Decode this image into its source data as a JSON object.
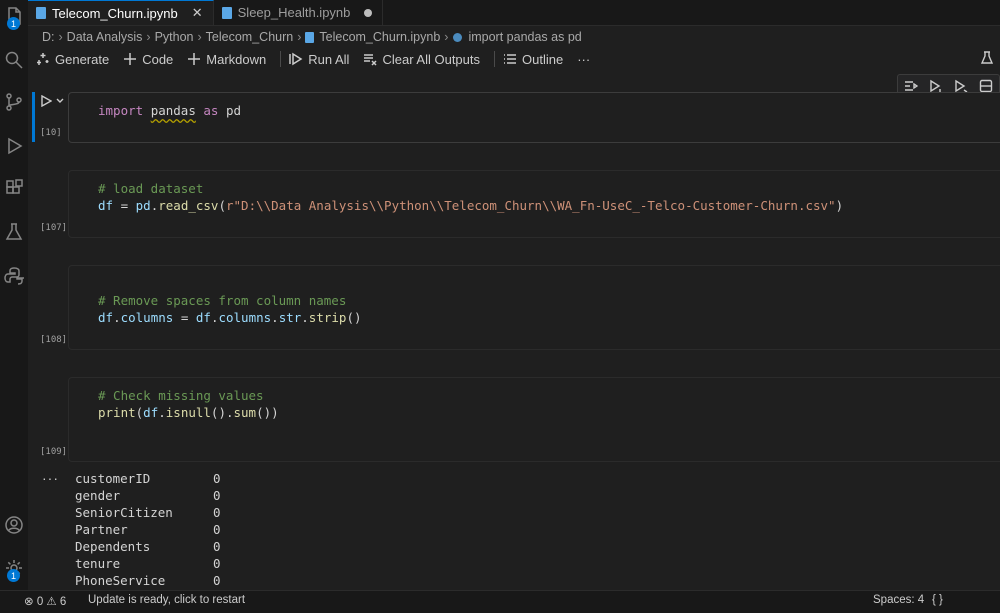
{
  "tabs": [
    {
      "label": "Telecom_Churn.ipynb",
      "active": true
    },
    {
      "label": "Sleep_Health.ipynb",
      "active": false
    }
  ],
  "breadcrumb": [
    "D:",
    "Data Analysis",
    "Python",
    "Telecom_Churn",
    "Telecom_Churn.ipynb",
    "import pandas as pd"
  ],
  "toolbar": {
    "generate": "Generate",
    "code": "Code",
    "markdown": "Markdown",
    "run_all": "Run All",
    "clear_outputs": "Clear All Outputs",
    "outline": "Outline",
    "more": "···"
  },
  "badges": {
    "explorer": "1",
    "settings": "1"
  },
  "cells": [
    {
      "exec": "[10]",
      "lines": [
        "import pandas as pd"
      ]
    },
    {
      "exec": "[107]",
      "lines": [
        "# load dataset",
        "df = pd.read_csv(r\"D:\\\\Data Analysis\\\\Python\\\\Telecom_Churn\\\\WA_Fn-UseC_-Telco-Customer-Churn.csv\")"
      ]
    },
    {
      "exec": "[108]",
      "lines": [
        "# Remove spaces from column names",
        "df.columns = df.columns.str.strip()"
      ]
    },
    {
      "exec": "[109]",
      "lines": [
        "# Check missing values",
        "print(df.isnull().sum())"
      ]
    }
  ],
  "output_more": "···",
  "output": [
    {
      "name": "customerID",
      "value": "0"
    },
    {
      "name": "gender",
      "value": "0"
    },
    {
      "name": "SeniorCitizen",
      "value": "0"
    },
    {
      "name": "Partner",
      "value": "0"
    },
    {
      "name": "Dependents",
      "value": "0"
    },
    {
      "name": "tenure",
      "value": "0"
    },
    {
      "name": "PhoneService",
      "value": "0"
    }
  ],
  "status": {
    "problems": "⊗ 0 ⚠ 6",
    "update": "Update is ready, click to restart",
    "spaces": "Spaces: 4",
    "braces": "{ }"
  },
  "colors": {
    "accent": "#0078d4",
    "background": "#1f1f1f"
  }
}
